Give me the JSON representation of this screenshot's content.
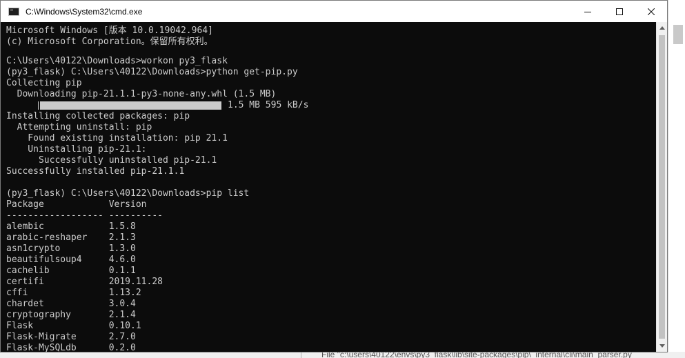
{
  "window": {
    "title": "C:\\Windows\\System32\\cmd.exe"
  },
  "console": {
    "lines": [
      "Microsoft Windows [版本 10.0.19042.964]",
      "(c) Microsoft Corporation。保留所有权利。",
      "",
      "C:\\Users\\40122\\Downloads>workon py3_flask",
      "(py3_flask) C:\\Users\\40122\\Downloads>python get-pip.py",
      "Collecting pip",
      "  Downloading pip-21.1.1-py3-none-any.whl (1.5 MB)",
      "",
      "Installing collected packages: pip",
      "  Attempting uninstall: pip",
      "    Found existing installation: pip 21.1",
      "    Uninstalling pip-21.1:",
      "      Successfully uninstalled pip-21.1",
      "Successfully installed pip-21.1.1",
      "",
      "(py3_flask) C:\\Users\\40122\\Downloads>pip list",
      "Package            Version",
      "------------------ ----------",
      "alembic            1.5.8",
      "arabic-reshaper    2.1.3",
      "asn1crypto         1.3.0",
      "beautifulsoup4     4.6.0",
      "cachelib           0.1.1",
      "certifi            2019.11.28",
      "cffi               1.13.2",
      "chardet            3.0.4",
      "cryptography       2.1.4",
      "Flask              0.10.1",
      "Flask-Migrate      2.7.0",
      "Flask-MySQLdb      0.2.0"
    ],
    "progress_line_index": 7,
    "progress": {
      "fraction": 1.0,
      "text": "1.5 MB 595 kB/s"
    }
  },
  "background": {
    "bottom_text": "File \"c:\\users\\40122\\envs\\py3_flask\\lib\\site-packages\\pip\\_internal\\cli\\main_parser.py"
  },
  "colors": {
    "console_bg": "#0c0c0c",
    "console_fg": "#cccccc",
    "titlebar_bg": "#ffffff"
  }
}
